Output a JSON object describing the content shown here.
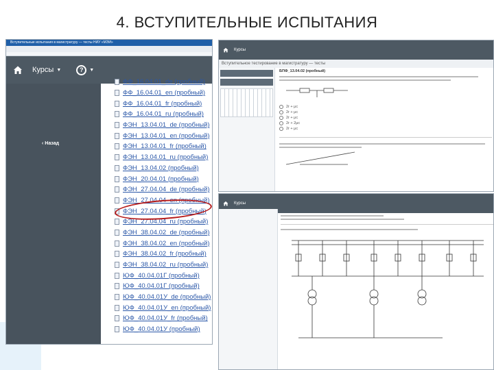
{
  "slide": {
    "title": "4. ВСТУПИТЕЛЬНЫЕ ИСПЫТАНИЯ"
  },
  "left_screenshot": {
    "browser_title": "Вступительные испытания в магистратуру — тесты    НИУ «МЭИ»",
    "nav": {
      "courses_label": "Курсы",
      "caret": "▼",
      "help_symbol": "?"
    },
    "sidebar": {
      "back_label": "‹  Назад"
    },
    "courses": [
      "ФФ_16.04.01_de (пробный)",
      "ФФ_16.04.01_en (пробный)",
      "ФФ_16.04.01_fr (пробный)",
      "ФФ_16.04.01_ru (пробный)",
      "ФЭН_13.04.01_de (пробный)",
      "ФЭН_13.04.01_en (пробный)",
      "ФЭН_13.04.01_fr (пробный)",
      "ФЭН_13.04.01_ru (пробный)",
      "ФЭН_13.04.02 (пробный)",
      "ФЭН_20.04.01 (пробный)",
      "ФЭН_27.04.04_de (пробный)",
      "ФЭН_27.04.04_en (пробный)",
      "ФЭН_27.04.04_fr (пробный)",
      "ФЭН_27.04.04_ru (пробный)",
      "ФЭН_38.04.02_de (пробный)",
      "ФЭН_38.04.02_en (пробный)",
      "ФЭН_38.04.02_fr (пробный)",
      "ФЭН_38.04.02_ru (пробный)",
      "ЮФ_40.04.01Г (пробный)",
      "ЮФ_40.04.01Г (пробный)",
      "ЮФ_40.04.01У_de (пробный)",
      "ЮФ_40.04.01У_en (пробный)",
      "ЮФ_40.04.01У_fr (пробный)",
      "ЮФ_40.04.01У (пробный)"
    ],
    "highlighted_course_index": 8,
    "highlight_color": "#b71c1c"
  },
  "right_top_screenshot": {
    "nav_courses_label": "Курсы",
    "breadcrumb": "Вступительное тестирование в магистратуру — тесты",
    "question_title": "БПФ_13.04.02 (пробный)",
    "answer_options": [
      "2r + μc",
      "2r + μc",
      "2r + μc",
      "2r + 2μс",
      "2r + μc"
    ]
  },
  "right_bottom_screenshot": {
    "nav_courses_label": "Курсы"
  },
  "colors": {
    "nav_bg": "#4d5963",
    "sidebar_bg": "#48535d",
    "link": "#2a57a8",
    "browser_bar": "#1f5fa8"
  },
  "icons": [
    "home-icon",
    "help-icon",
    "document-icon"
  ]
}
